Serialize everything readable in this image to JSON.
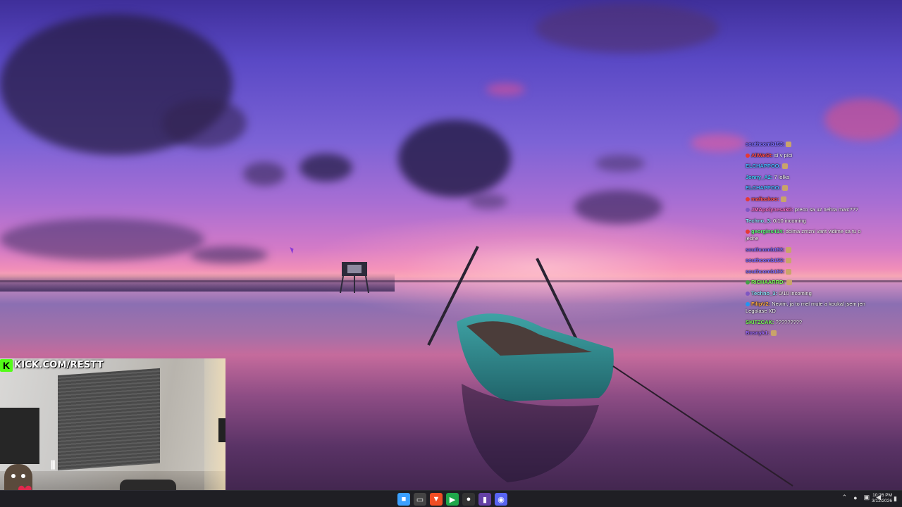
{
  "stream_overlay": {
    "banner_text": "KICK.COM/RESTT"
  },
  "chat": [
    {
      "user": "southcomb153:",
      "text": "",
      "user_color": "#7b6cff",
      "badge_color": "",
      "emote": true
    },
    {
      "user": "AliWeSt:",
      "text": "sí v píci",
      "user_color": "#ff4a4a",
      "badge_color": "#e53935",
      "emote": false
    },
    {
      "user": "ELCHAPPOO:",
      "text": "",
      "user_color": "#47b6ff",
      "badge_color": "",
      "emote": true
    },
    {
      "user": "Jonny_A2:",
      "text": "7 lolka",
      "user_color": "#3fd0ff",
      "badge_color": "",
      "emote": false
    },
    {
      "user": "ELCHAPPOO:",
      "text": "",
      "user_color": "#47b6ff",
      "badge_color": "",
      "emote": true
    },
    {
      "user": "mafiaskoo:",
      "text": "",
      "user_color": "#ff5252",
      "badge_color": "#e53935",
      "emote": true
    },
    {
      "user": "JMApolynesakti:",
      "text": "preco sa uz nehra mwc???",
      "user_color": "#ff6ec7",
      "badge_color": "#7e57c2",
      "emote": false
    },
    {
      "user": "Techno_3:",
      "text": "0/10 incoming",
      "user_color": "#8ae6ff",
      "badge_color": "",
      "emote": false
    },
    {
      "user": "georgins414:",
      "text": "dolma zmzni varit vidime sa tu o jedne",
      "user_color": "#5cff7a",
      "badge_color": "#e53935",
      "emote": false
    },
    {
      "user": "southcomb153:",
      "text": "",
      "user_color": "#7b6cff",
      "badge_color": "",
      "emote": true
    },
    {
      "user": "southcomb153:",
      "text": "",
      "user_color": "#7b6cff",
      "badge_color": "",
      "emote": true
    },
    {
      "user": "southcomb153:",
      "text": "",
      "user_color": "#7b6cff",
      "badge_color": "",
      "emote": true
    },
    {
      "user": "RICHAARRD:",
      "text": "",
      "user_color": "#7dff5c",
      "badge_color": "#43a047",
      "emote": true
    },
    {
      "user": "Techno_3:",
      "text": "0/10 incoming",
      "user_color": "#8ae6ff",
      "badge_color": "#7e57c2",
      "emote": false
    },
    {
      "user": "FilipV2:",
      "text": "Nevim, ja to mel mute a koukal jsem jen Legolase XD",
      "user_color": "#ffab40",
      "badge_color": "#2196f3",
      "emote": false
    },
    {
      "user": "SKITZCAK:",
      "text": "?????????",
      "user_color": "#7dff5c",
      "badge_color": "",
      "emote": false
    },
    {
      "user": "Bosnyk1:",
      "text": "",
      "user_color": "#a06bff",
      "badge_color": "",
      "emote": true
    }
  ],
  "taskbar": {
    "icons": [
      {
        "name": "start-icon",
        "color": "#3aa0ff",
        "glyph": "■"
      },
      {
        "name": "task-view-icon",
        "color": "#444",
        "glyph": "▭"
      },
      {
        "name": "brave-browser-icon",
        "color": "#f04d23",
        "glyph": "▼"
      },
      {
        "name": "kick-app-icon",
        "color": "#1fa84a",
        "glyph": "▶"
      },
      {
        "name": "obs-icon",
        "color": "#333",
        "glyph": "●"
      },
      {
        "name": "twitch-icon",
        "color": "#6441a5",
        "glyph": "▮"
      },
      {
        "name": "discord-icon",
        "color": "#5865f2",
        "glyph": "◉"
      }
    ],
    "clock_time": "10:26 PM",
    "clock_date": "3/12/2026"
  }
}
